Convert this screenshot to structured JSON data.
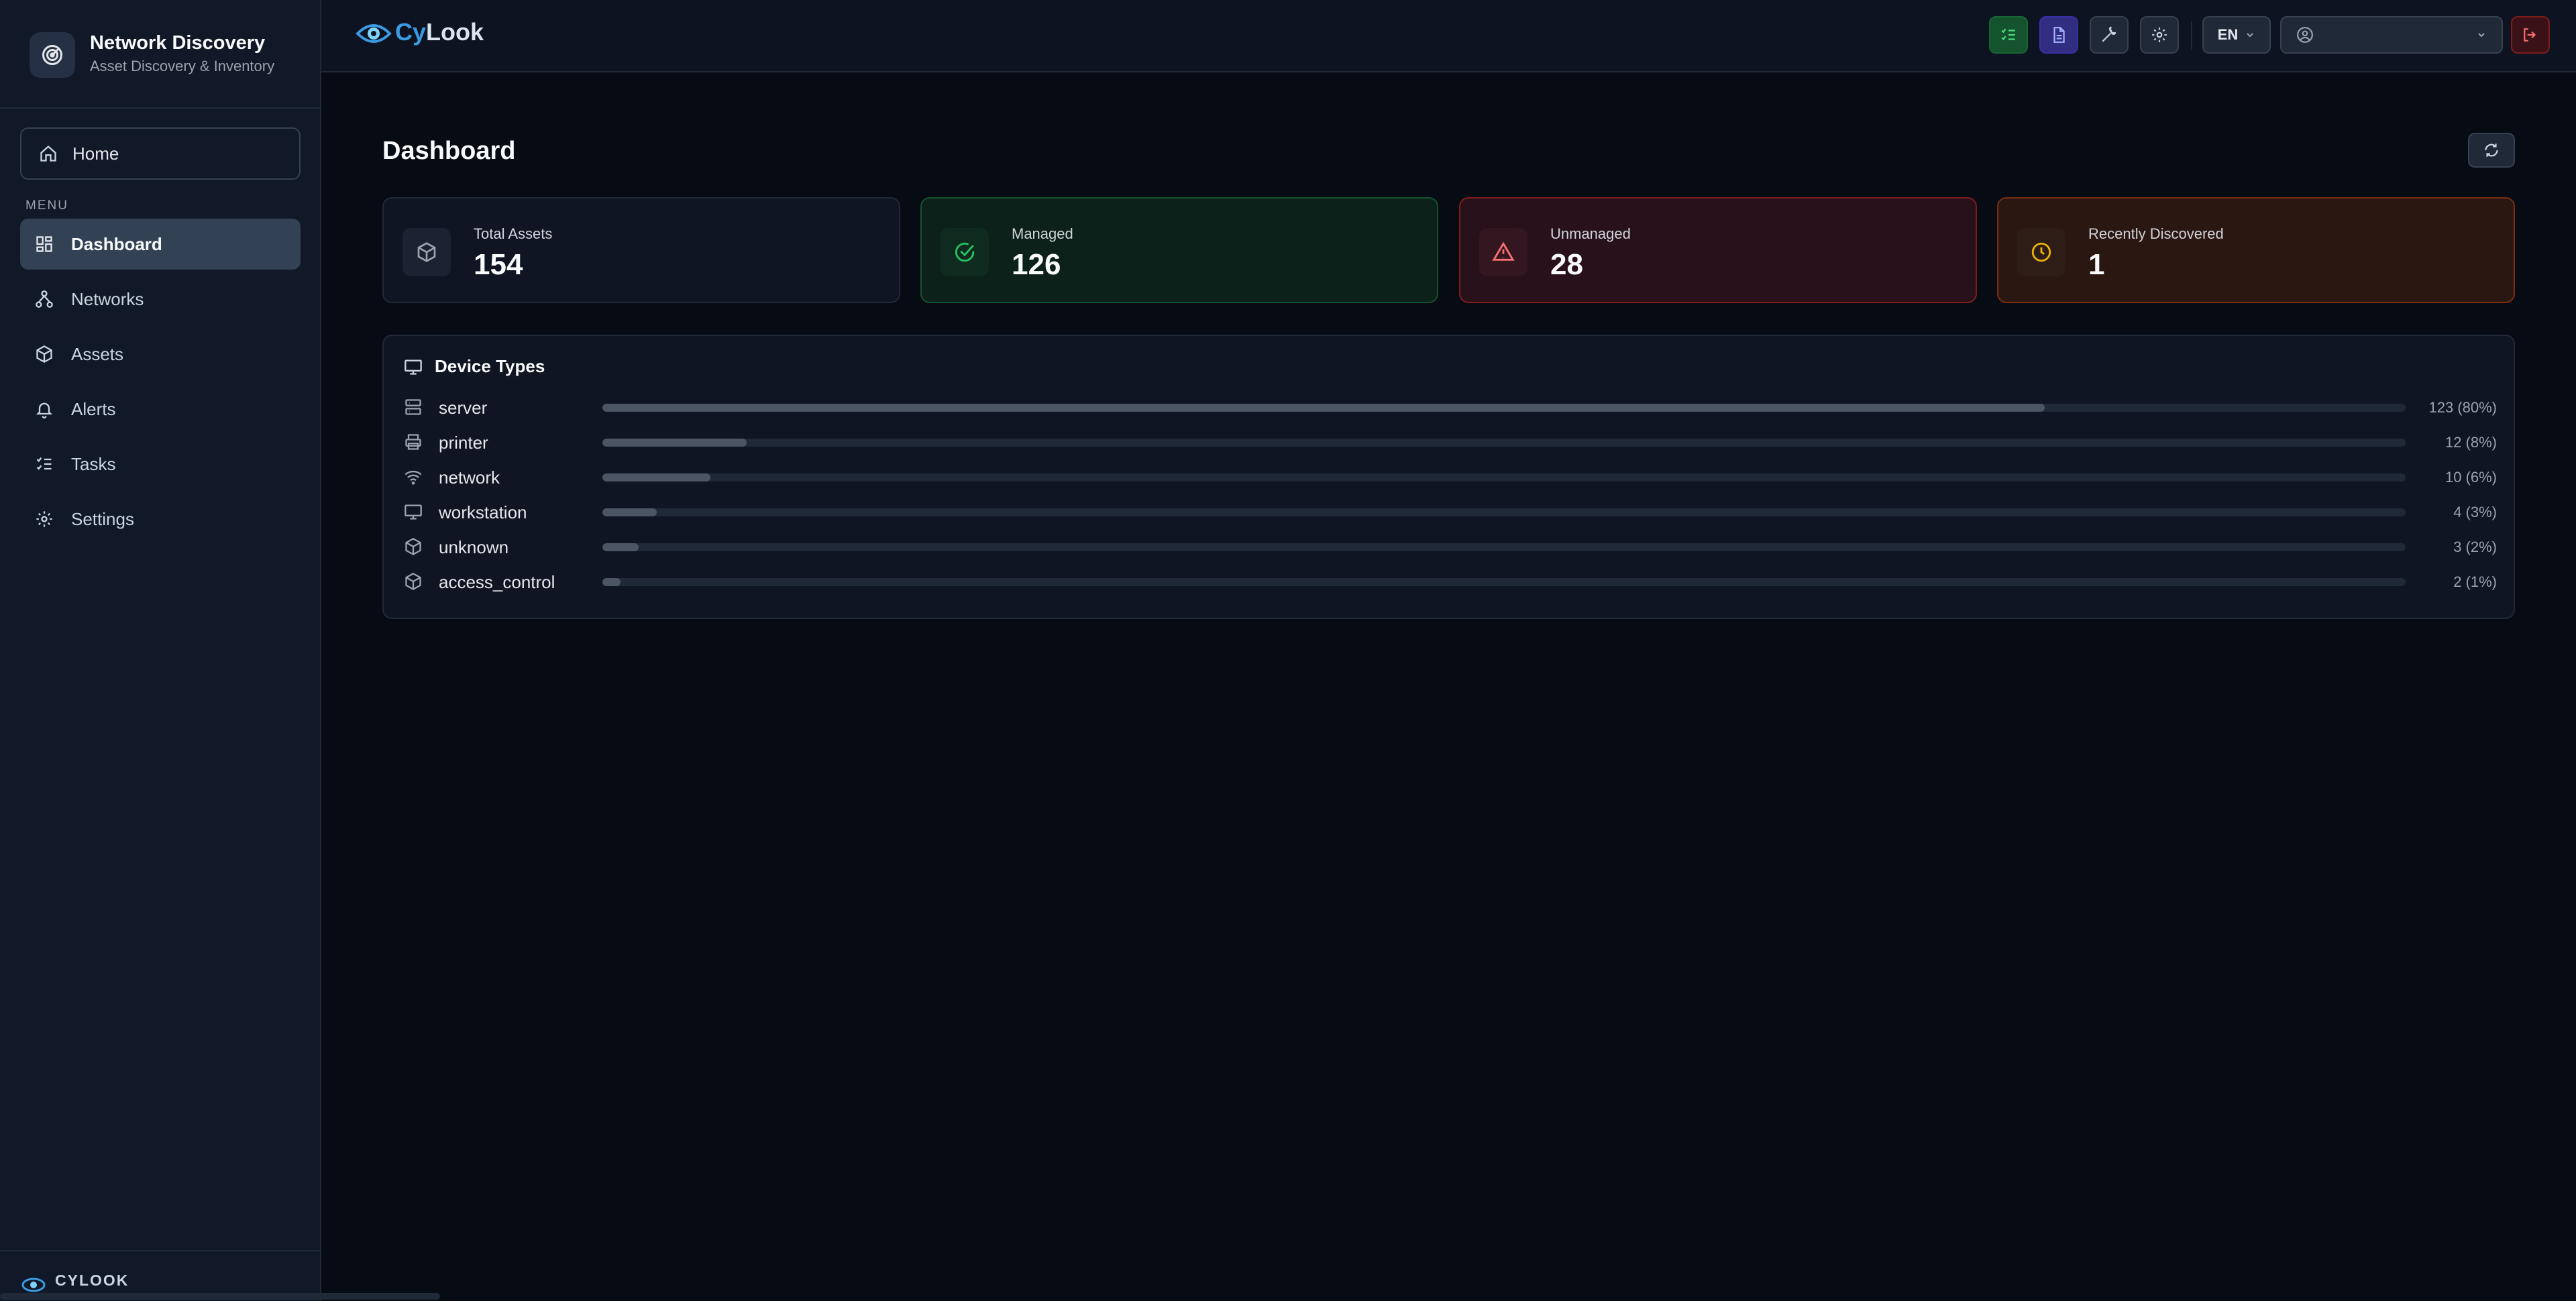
{
  "sidebar": {
    "brand_title": "Network Discovery",
    "brand_subtitle": "Asset Discovery & Inventory",
    "home_label": "Home",
    "menu_label": "MENU",
    "items": [
      {
        "label": "Dashboard",
        "icon": "dashboard-icon",
        "active": true
      },
      {
        "label": "Networks",
        "icon": "network-icon"
      },
      {
        "label": "Assets",
        "icon": "cube-icon"
      },
      {
        "label": "Alerts",
        "icon": "bell-icon"
      },
      {
        "label": "Tasks",
        "icon": "tasks-icon"
      },
      {
        "label": "Settings",
        "icon": "gear-icon"
      }
    ],
    "footer_label": "CYLOOK"
  },
  "topbar": {
    "logo_prefix": "Cy",
    "logo_suffix": "Look",
    "language": "EN",
    "user_value": ""
  },
  "main": {
    "title": "Dashboard",
    "stats": {
      "total": {
        "label": "Total Assets",
        "value": "154"
      },
      "managed": {
        "label": "Managed",
        "value": "126"
      },
      "unmanaged": {
        "label": "Unmanaged",
        "value": "28"
      },
      "recent": {
        "label": "Recently Discovered",
        "value": "1"
      }
    },
    "device_types": {
      "title": "Device Types",
      "rows": [
        {
          "name": "server",
          "icon": "server-icon",
          "fraction": 0.8,
          "count_label": "123 (80%)"
        },
        {
          "name": "printer",
          "icon": "printer-icon",
          "fraction": 0.08,
          "count_label": "12 (8%)"
        },
        {
          "name": "network",
          "icon": "wifi-icon",
          "fraction": 0.06,
          "count_label": "10 (6%)"
        },
        {
          "name": "workstation",
          "icon": "monitor-icon",
          "fraction": 0.03,
          "count_label": "4 (3%)"
        },
        {
          "name": "unknown",
          "icon": "cube-icon",
          "fraction": 0.02,
          "count_label": "3 (2%)"
        },
        {
          "name": "access_control",
          "icon": "cube-icon",
          "fraction": 0.01,
          "count_label": "2 (1%)"
        }
      ]
    }
  },
  "colors": {
    "background": "#070b14",
    "sidebar": "#111827",
    "managed_accent": "#22c55e",
    "unmanaged_accent": "#f87171",
    "recent_accent": "#eab308",
    "bar_fill": "#4b5563"
  }
}
